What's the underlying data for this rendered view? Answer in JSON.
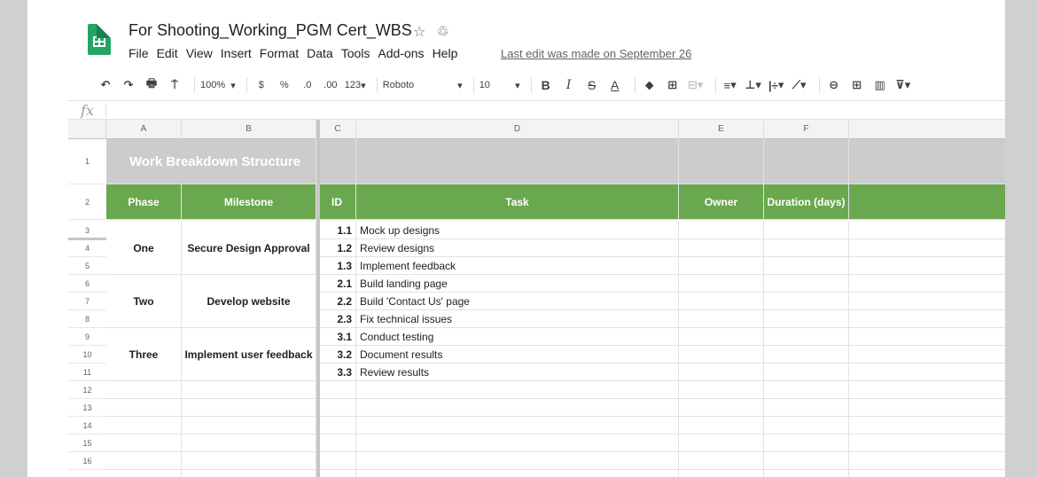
{
  "app": {
    "doc_title": "For Shooting_Working_PGM Cert_WBS",
    "star_icon": "star-icon",
    "move_icon": "cloud-status-icon",
    "last_edit": "Last edit was made on September 26"
  },
  "menu": [
    "File",
    "Edit",
    "View",
    "Insert",
    "Format",
    "Data",
    "Tools",
    "Add-ons",
    "Help"
  ],
  "toolbar": {
    "undo": "↶",
    "redo": "↷",
    "print": "🖶",
    "paint_format": "⍑",
    "zoom": "100%",
    "zoom_caret": "▾",
    "currency": "$",
    "percent": "%",
    "dec_decrease": ".0",
    "dec_increase": ".00",
    "more_formats": "123",
    "more_formats_caret": "▾",
    "font": "Roboto",
    "font_caret": "▾",
    "font_size": "10",
    "size_caret": "▾",
    "bold": "B",
    "italic": "I",
    "strike": "S",
    "text_color": "A",
    "fill_color": "⬥",
    "borders": "⊞",
    "merge": "⊟",
    "merge_caret": "▾",
    "h_align": "≡",
    "h_align_caret": "▾",
    "v_align": "⊥",
    "v_align_caret": "▾",
    "wrap": "|÷",
    "wrap_caret": "▾",
    "rotate": "⟋",
    "rotate_caret": "▾",
    "link": "⊖",
    "comment": "⊞",
    "chart": "▥",
    "filter": "⊽",
    "filter_caret": "▾"
  },
  "formula_bar": {
    "fx": "fx",
    "value": ""
  },
  "columns": [
    "A",
    "B",
    "C",
    "D",
    "E",
    "F"
  ],
  "rows": [
    "1",
    "2",
    "3",
    "4",
    "5",
    "6",
    "7",
    "8",
    "9",
    "10",
    "11",
    "12",
    "13",
    "14",
    "15",
    "16"
  ],
  "sheet": {
    "title": "Work Breakdown Structure",
    "headers": {
      "phase": "Phase",
      "milestone": "Milestone",
      "id": "ID",
      "task": "Task",
      "owner": "Owner",
      "duration": "Duration (days)"
    },
    "phases": [
      {
        "phase": "One",
        "milestone": "Secure Design Approval"
      },
      {
        "phase": "Two",
        "milestone": "Develop website"
      },
      {
        "phase": "Three",
        "milestone": "Implement user feedback"
      }
    ],
    "tasks": [
      {
        "id": "1.1",
        "task": "Mock up designs"
      },
      {
        "id": "1.2",
        "task": "Review designs"
      },
      {
        "id": "1.3",
        "task": "Implement feedback"
      },
      {
        "id": "2.1",
        "task": "Build landing page"
      },
      {
        "id": "2.2",
        "task": "Build 'Contact Us' page"
      },
      {
        "id": "2.3",
        "task": "Fix technical issues"
      },
      {
        "id": "3.1",
        "task": "Conduct testing"
      },
      {
        "id": "3.2",
        "task": "Document results"
      },
      {
        "id": "3.3",
        "task": "Review results"
      }
    ]
  }
}
